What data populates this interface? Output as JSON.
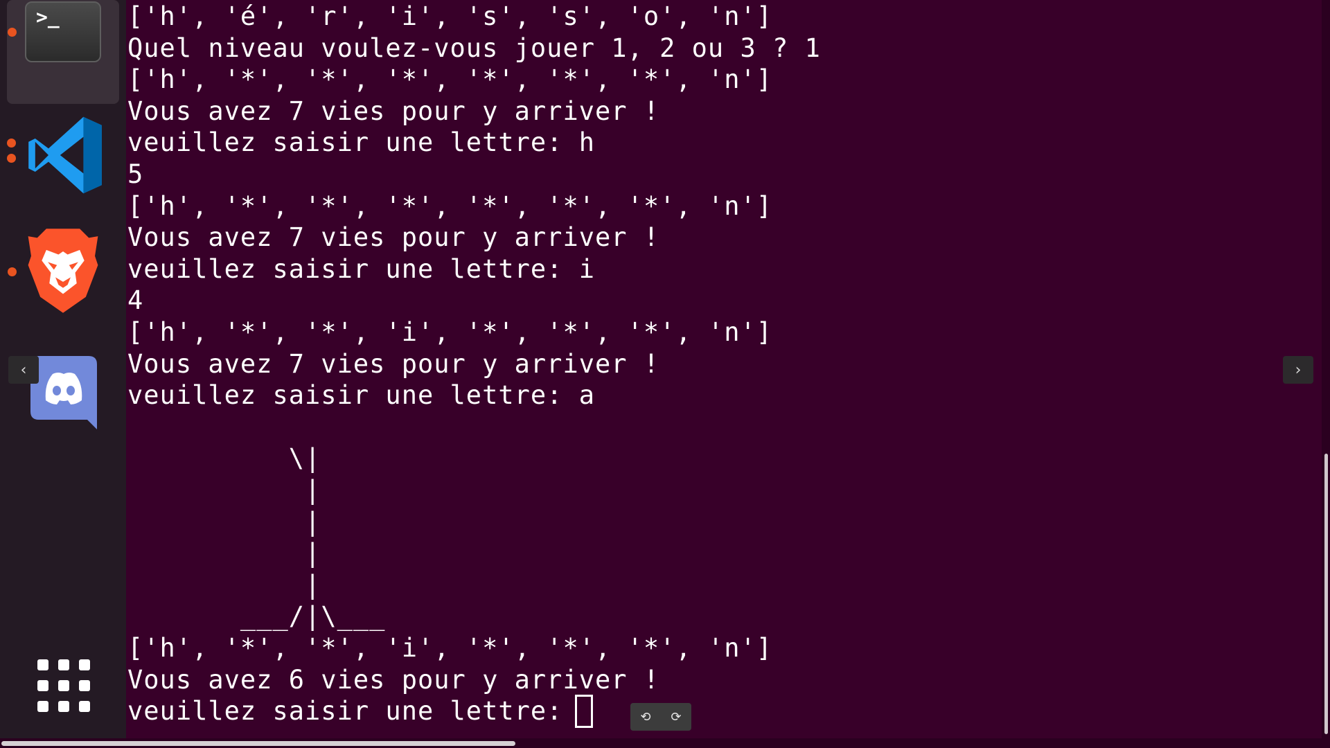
{
  "dock": {
    "terminal_prompt": ">_",
    "apps": [
      "Terminal",
      "Visual Studio Code",
      "Brave Browser",
      "Discord",
      "Show Applications"
    ]
  },
  "terminal": {
    "lines": [
      "['h', 'é', 'r', 'i', 's', 's', 'o', 'n']",
      "Quel niveau voulez-vous jouer 1, 2 ou 3 ? 1",
      "['h', '*', '*', '*', '*', '*', '*', 'n']",
      "Vous avez 7 vies pour y arriver !",
      "veuillez saisir une lettre: h",
      "5",
      "['h', '*', '*', '*', '*', '*', '*', 'n']",
      "Vous avez 7 vies pour y arriver !",
      "veuillez saisir une lettre: i",
      "4",
      "['h', '*', '*', 'i', '*', '*', '*', 'n']",
      "Vous avez 7 vies pour y arriver !",
      "veuillez saisir une lettre: a",
      "",
      "          \\|",
      "           |",
      "           |",
      "           |",
      "           |",
      "       ___/|\\___",
      "['h', '*', '*', 'i', '*', '*', '*', 'n']",
      "Vous avez 6 vies pour y arriver !",
      "veuillez saisir une lettre: "
    ]
  },
  "controls": {
    "prev": "‹",
    "next": "›",
    "rotate_left": "⟲",
    "rotate_right": "⟳"
  },
  "colors": {
    "terminal_bg": "#380029",
    "dock_bg": "#241a24",
    "accent": "#e95420"
  }
}
